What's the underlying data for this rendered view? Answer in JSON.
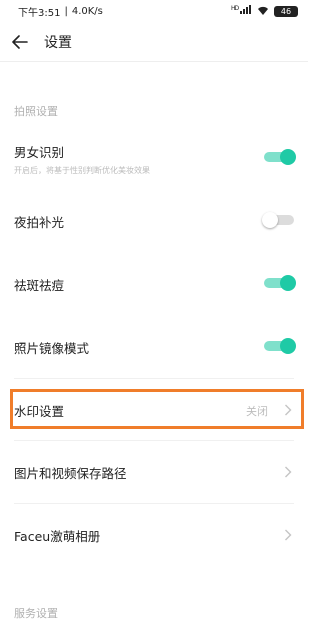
{
  "status_bar": {
    "time": "下午3:51",
    "speed": "4.0K/s",
    "signal": "HD",
    "battery": "46"
  },
  "header": {
    "title": "设置"
  },
  "sections": {
    "photo_header": "拍照设置",
    "service_header": "服务设置"
  },
  "settings": {
    "gender": {
      "label": "男女识别",
      "desc": "开启后，将基于性别判断优化美妆效果",
      "enabled": true
    },
    "night": {
      "label": "夜拍补光",
      "enabled": false
    },
    "acne": {
      "label": "祛斑祛痘",
      "enabled": true
    },
    "mirror": {
      "label": "照片镜像模式",
      "enabled": true
    },
    "watermark": {
      "label": "水印设置",
      "value": "关闭"
    },
    "save_path": {
      "label": "图片和视频保存路径"
    },
    "album": {
      "label": "Faceu激萌相册"
    }
  },
  "colors": {
    "accent": "#1fcaa6",
    "highlight": "#f07d2a"
  }
}
